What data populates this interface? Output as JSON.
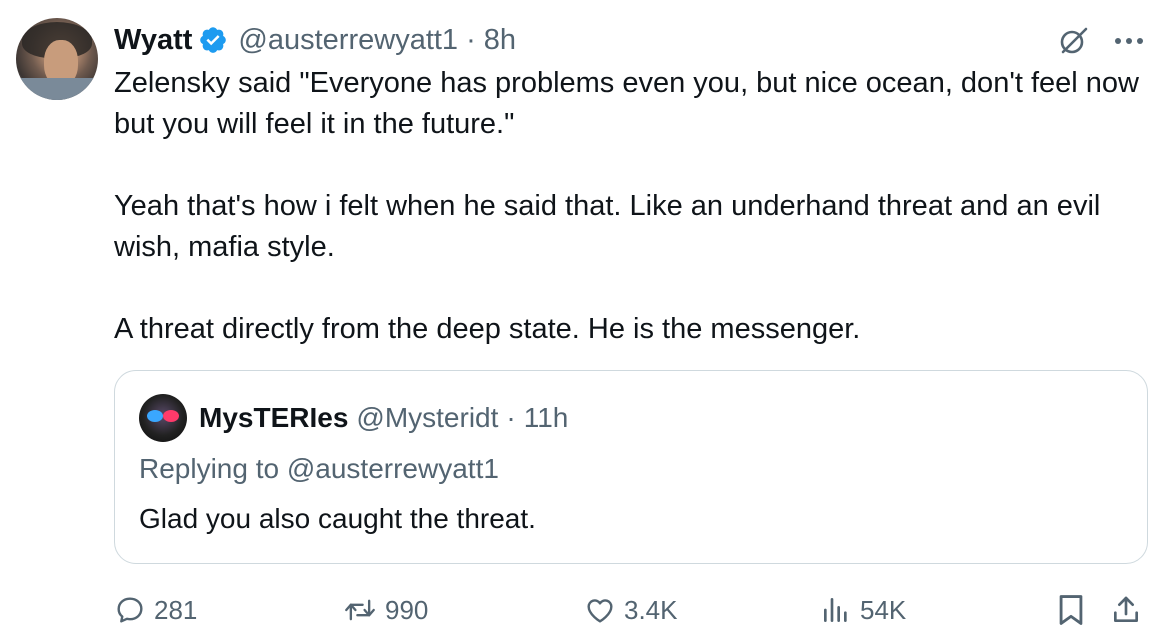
{
  "tweet": {
    "author": {
      "name": "Wyatt",
      "handle": "@austerrewyatt1",
      "verified": true,
      "verified_color": "#1d9bf0"
    },
    "separator": "·",
    "time": "8h",
    "paragraphs": [
      "Zelensky said \"Everyone has problems even you, but nice ocean, don't feel now but you will feel it in the future.\"",
      "Yeah that's how i felt when he said that. Like an underhand threat and an evil wish, mafia style.",
      "A threat directly from the deep state. He is the messenger."
    ],
    "top_icons": [
      "grok-icon",
      "more-icon"
    ]
  },
  "quote": {
    "author": {
      "name": "MysTERIes",
      "handle": "@Mysteridt"
    },
    "separator": "·",
    "time": "11h",
    "replying_to": "Replying to @austerrewyatt1",
    "text": "Glad you also caught the threat."
  },
  "actions": {
    "replies": "281",
    "retweets": "990",
    "likes": "3.4K",
    "views": "54K"
  },
  "colors": {
    "text_primary": "#0f1419",
    "text_secondary": "#536471",
    "border": "#cfd9de",
    "accent": "#1d9bf0"
  }
}
